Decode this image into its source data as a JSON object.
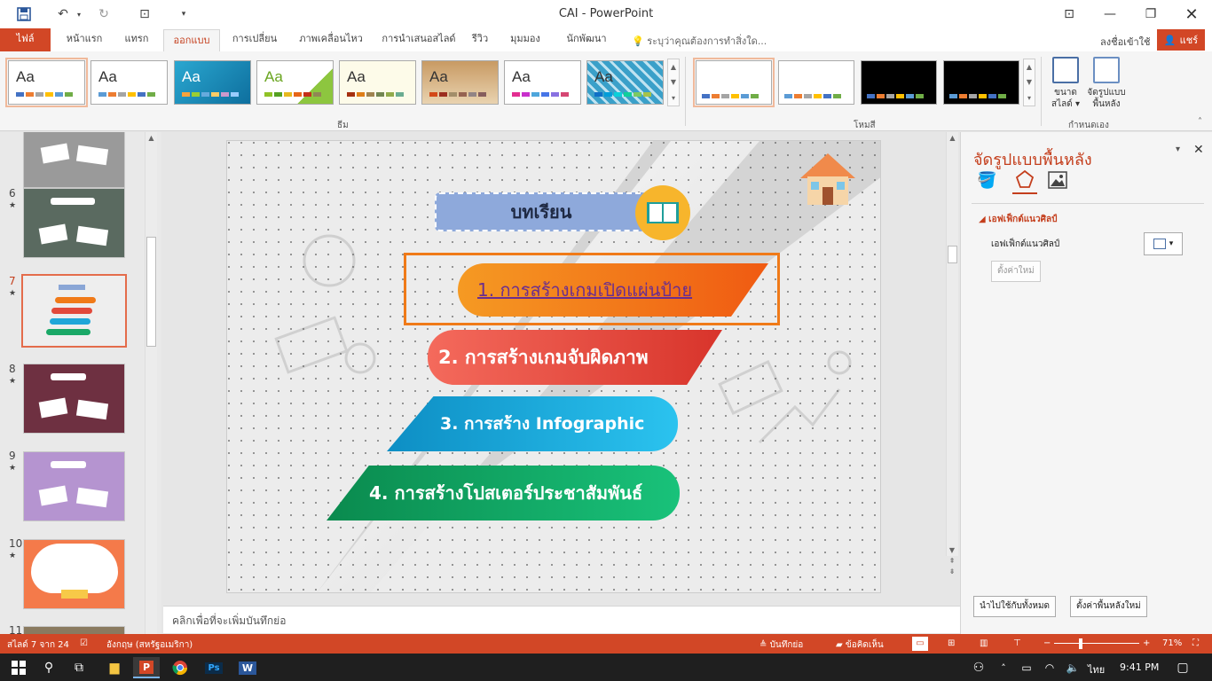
{
  "window": {
    "title": "CAI - PowerPoint"
  },
  "tabs": [
    "ไฟล์",
    "หน้าแรก",
    "แทรก",
    "ออกแบบ",
    "การเปลี่ยน",
    "ภาพเคลื่อนไหว",
    "การนำเสนอสไลด์",
    "รีวิว",
    "มุมมอง",
    "นักพัฒนา"
  ],
  "tellme": "ระบุว่าคุณต้องการทำสิ่งใด...",
  "signin": "ลงชื่อเข้าใช้",
  "share": "แชร์",
  "ribbon": {
    "themes_label": "ธีม",
    "variants_label": "โหมสี",
    "customize_label": "กำหนดเอง",
    "theme_aa": "Aa",
    "slide_size": [
      "ขนาด",
      "สไลด์"
    ],
    "format_bg": [
      "จัดรูปแบบ",
      "พื้นหลัง"
    ]
  },
  "slides": [
    {
      "num": "6",
      "star": "★"
    },
    {
      "num": "7",
      "star": "★"
    },
    {
      "num": "8",
      "star": "★"
    },
    {
      "num": "9",
      "star": "★"
    },
    {
      "num": "10",
      "star": "★"
    },
    {
      "num": "11",
      "star": ""
    }
  ],
  "slide": {
    "header": "บทเรียน",
    "items": [
      "1. การสร้างเกมเปิดแผ่นป้าย",
      "2. การสร้างเกมจับผิดภาพ",
      "3. การสร้าง Infographic",
      "4. การสร้างโปสเตอร์ประชาสัมพันธ์"
    ]
  },
  "notes": "คลิกเพื่อที่จะเพิ่มบันทึกย่อ",
  "pane": {
    "title": "จัดรูปแบบพื้นหลัง",
    "section": "เอฟเฟ็กต์แนวศิลป์",
    "field_label": "เอฟเฟ็กต์แนวศิลป์",
    "reset": "ตั้งค่าใหม่",
    "apply_all": "นำไปใช้กับทั้งหมด",
    "reset_bg": "ตั้งค่าพื้นหลังใหม่"
  },
  "status": {
    "slide_pos": "สไลด์ 7 จาก 24",
    "language": "อังกฤษ (สหรัฐอเมริกา)",
    "notes_btn": "บันทึกย่อ",
    "comments_btn": "ข้อคิดเห็น",
    "zoom": "71%"
  },
  "taskbar": {
    "lang": "ไทย",
    "time": "9:41 PM"
  },
  "colors": {
    "accent": "#d24726",
    "orange": "#f07a18",
    "red": "#e2493b",
    "cyan": "#1fa6d8",
    "green": "#1aa867"
  }
}
